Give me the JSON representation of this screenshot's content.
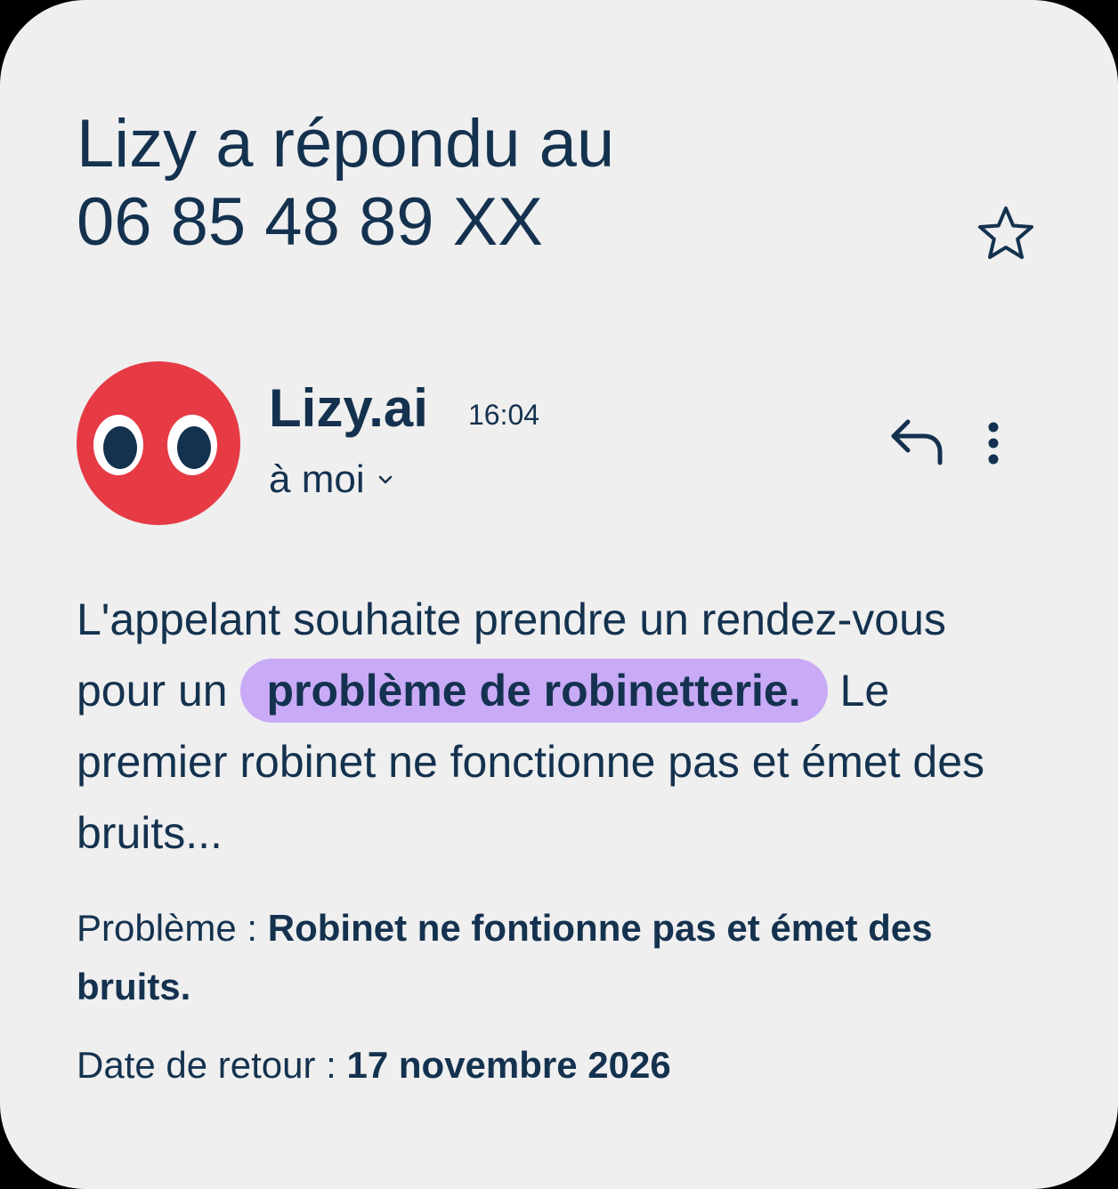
{
  "email": {
    "subject_line1": "Lizy a répondu au",
    "subject_line2": "06 85 48 89 XX",
    "sender": {
      "name": "Lizy.ai",
      "time": "16:04",
      "recipient": "à moi"
    },
    "body": {
      "intro_before": "L'appelant souhaite prendre un rendez-vous pour un",
      "highlight": "problème de robinetterie.",
      "intro_after": "Le premier robinet ne fonctionne pas et émet des bruits..."
    },
    "fields": {
      "problem_label": "Problème :",
      "problem_value": "Robinet ne fontionne pas et émet des bruits.",
      "date_label": "Date de retour :",
      "date_value": "17 novembre 2026"
    }
  },
  "icons": {
    "star": "star-outline-icon",
    "reply": "reply-arrow-icon",
    "more": "more-vertical-icon",
    "chevron": "chevron-down-icon",
    "avatar": "lizy-eyes-logo"
  },
  "colors": {
    "background": "#efefef",
    "text": "#14324f",
    "avatar_red": "#e63a45",
    "highlight": "#c9aaf7"
  }
}
